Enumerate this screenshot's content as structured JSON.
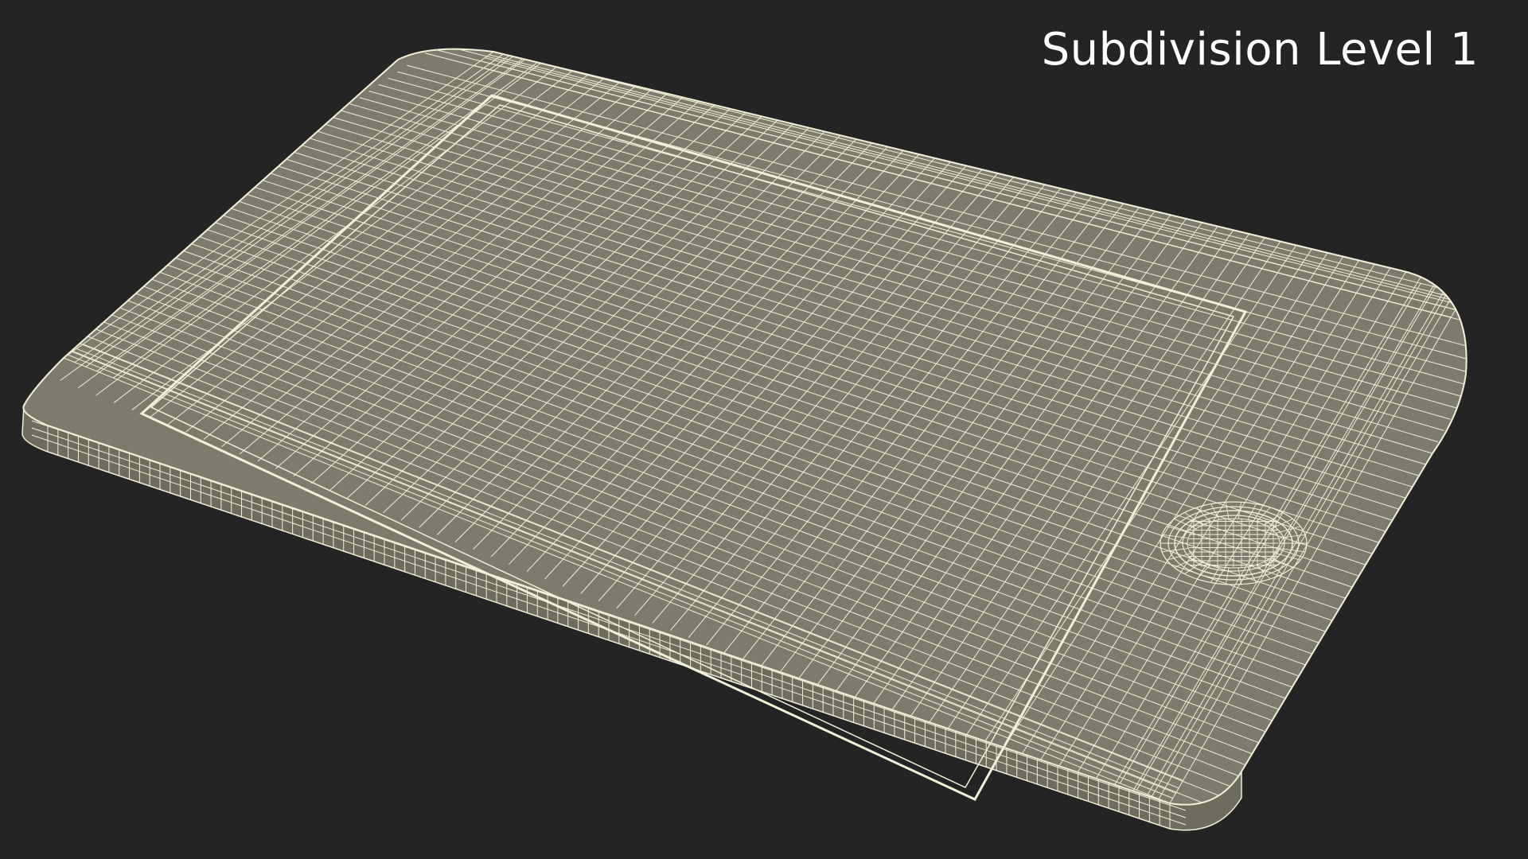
{
  "viewport": {
    "label": "Subdivision Level 1",
    "background_color": "#242424",
    "model": {
      "name": "tablet-wireframe-model",
      "surface_color": "#7d7b6b",
      "side_color": "#6e6c5d",
      "wire_color": "#f1f0d8"
    }
  }
}
